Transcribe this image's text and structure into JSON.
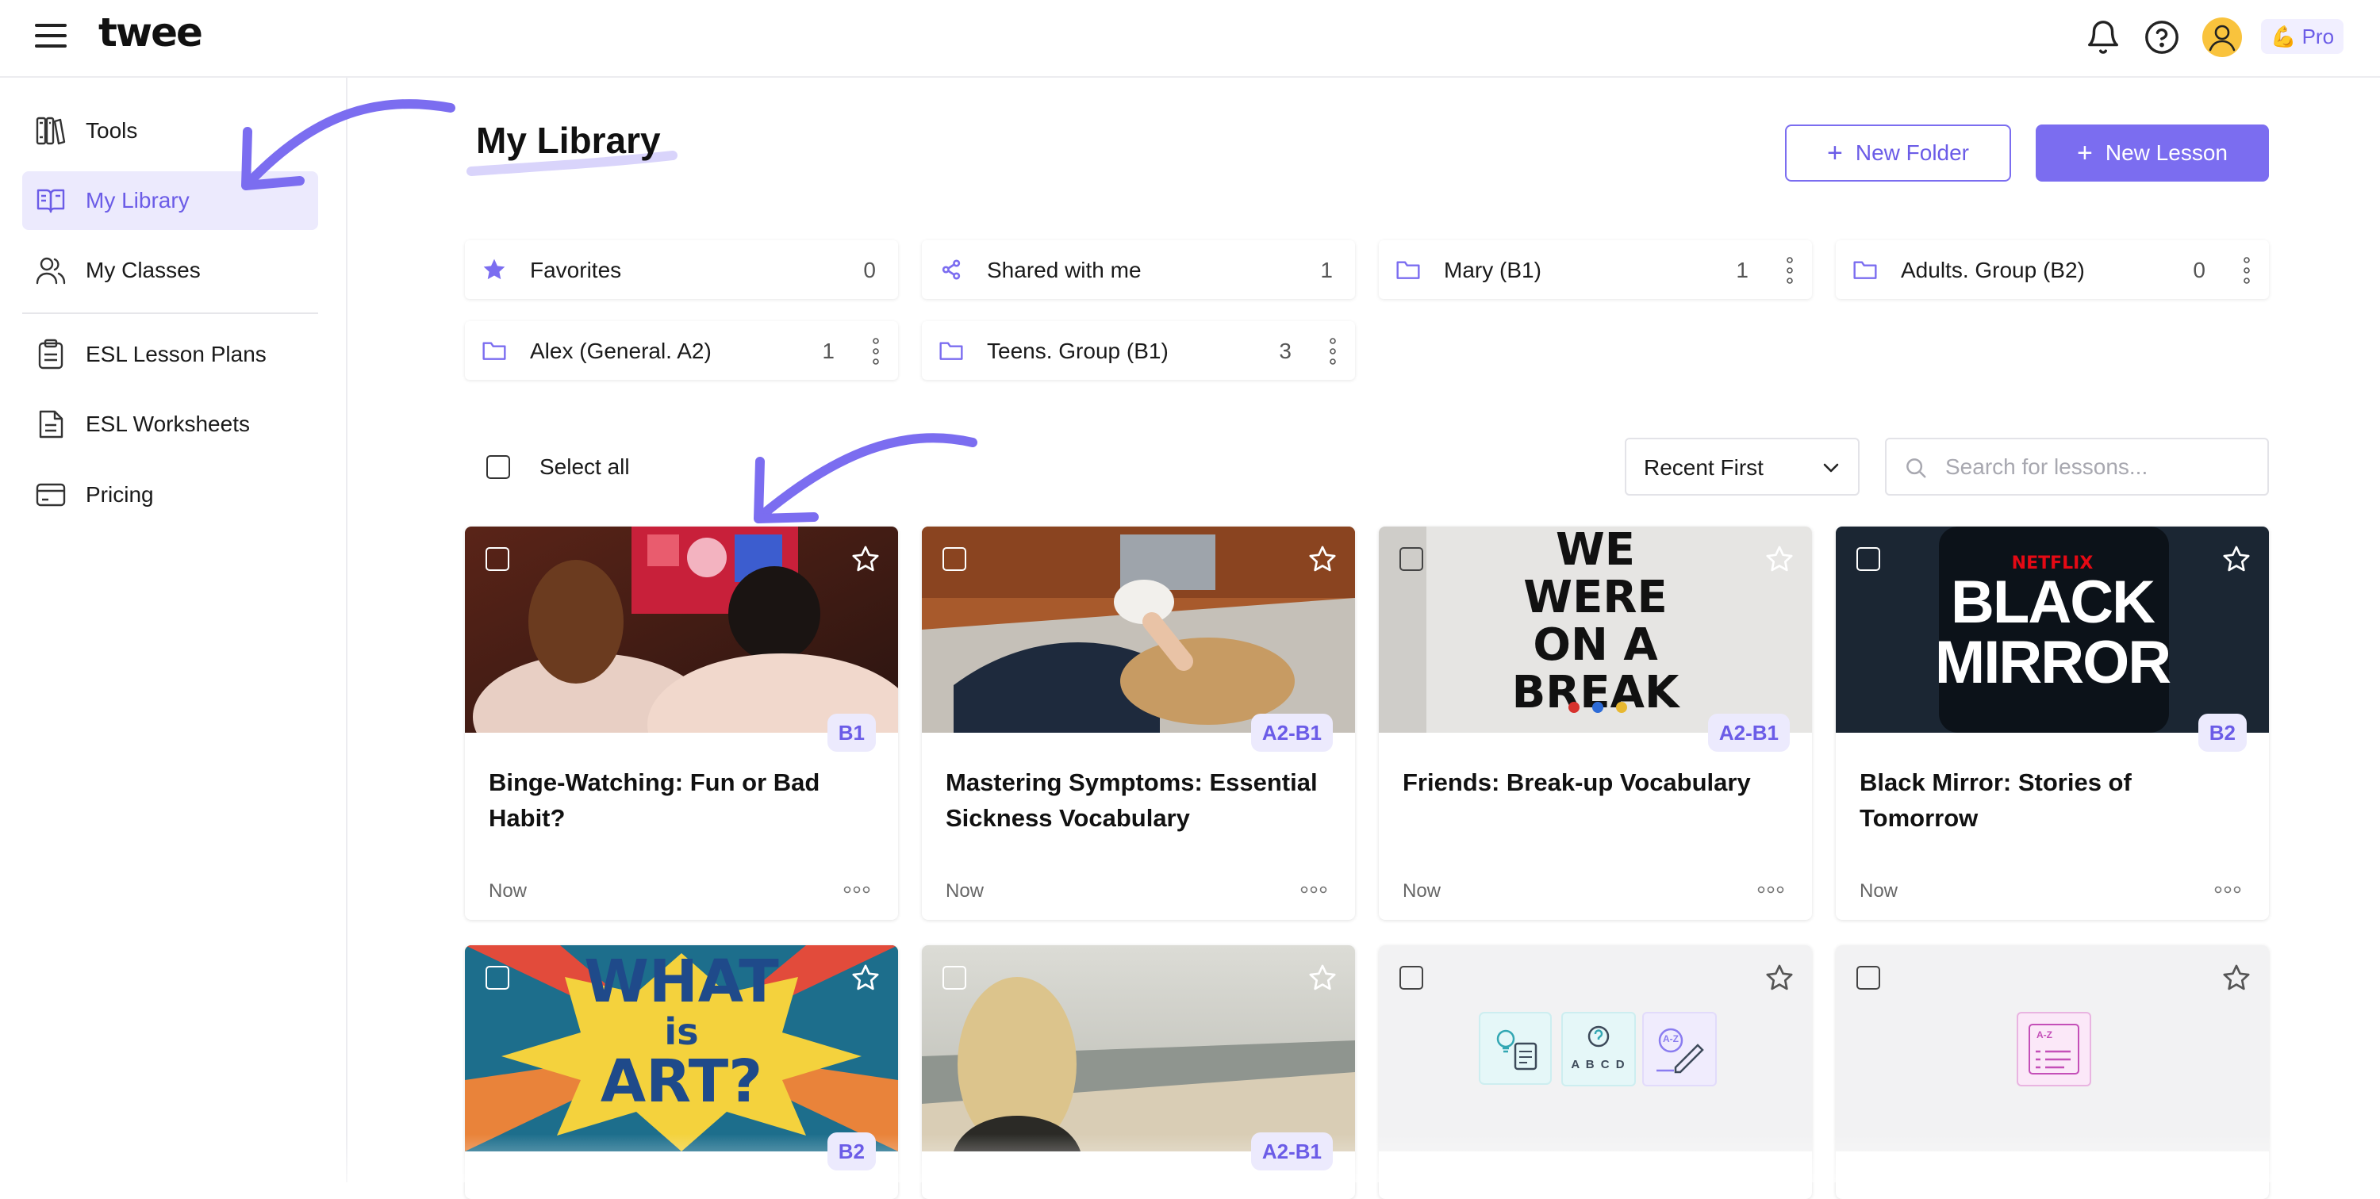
{
  "app": {
    "logo": "twee",
    "plan_badge": "Pro",
    "plan_emoji": "💪"
  },
  "sidebar": {
    "items": [
      {
        "label": "Tools",
        "icon": "tools-icon"
      },
      {
        "label": "My Library",
        "icon": "book-open-icon",
        "active": true
      },
      {
        "label": "My Classes",
        "icon": "users-icon"
      },
      {
        "label": "ESL Lesson Plans",
        "icon": "clipboard-icon"
      },
      {
        "label": "ESL Worksheets",
        "icon": "worksheet-icon"
      },
      {
        "label": "Pricing",
        "icon": "credit-card-icon"
      }
    ]
  },
  "main": {
    "title": "My Library",
    "new_folder": "New Folder",
    "new_lesson": "New Lesson",
    "folders": [
      {
        "name": "Favorites",
        "count": "0",
        "icon": "star-icon"
      },
      {
        "name": "Shared with me",
        "count": "1",
        "icon": "share-icon"
      },
      {
        "name": "Mary (B1)",
        "count": "1",
        "icon": "folder-icon"
      },
      {
        "name": "Adults. Group (B2)",
        "count": "0",
        "icon": "folder-icon"
      },
      {
        "name": "Alex (General. A2)",
        "count": "1",
        "icon": "folder-icon"
      },
      {
        "name": "Teens. Group (B1)",
        "count": "3",
        "icon": "folder-icon"
      }
    ],
    "select_all": "Select all",
    "sort": "Recent First",
    "search_placeholder": "Search for lessons...",
    "cards": [
      {
        "title": "Binge-Watching: Fun or Bad Habit?",
        "level": "B1",
        "date": "Now"
      },
      {
        "title": "Mastering Symptoms: Essential Sickness Vocabulary",
        "level": "A2-B1",
        "date": "Now"
      },
      {
        "title": "Friends: Break-up Vocabulary",
        "level": "A2-B1",
        "date": "Now"
      },
      {
        "title": "Black Mirror: Stories of Tomorrow",
        "level": "B2",
        "date": "Now"
      },
      {
        "level": "B2"
      },
      {
        "level": "A2-B1"
      },
      {},
      {}
    ],
    "thumb_text": {
      "friends": [
        "WE",
        "WERE",
        "ON A",
        "BREAK"
      ],
      "netflix": "NETFLIX",
      "black_mirror": [
        "BLACK",
        "MIRROR"
      ],
      "art": [
        "WHAT",
        "is",
        "ART?"
      ],
      "quiz_letters": "A B C D",
      "az": "A-Z"
    }
  },
  "colors": {
    "accent": "#7b6df0",
    "accent_text": "#6b5ce7",
    "accent_soft": "#eceafd"
  }
}
